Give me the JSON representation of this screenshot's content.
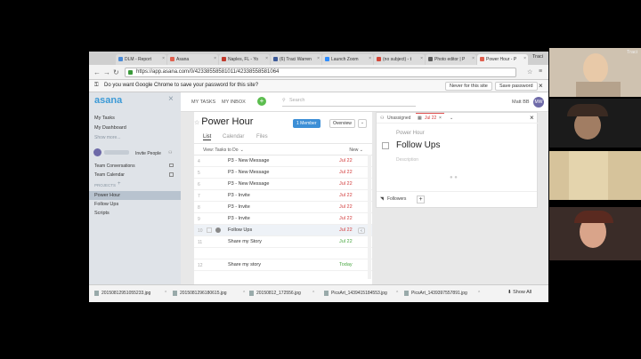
{
  "browser": {
    "tabs": [
      {
        "label": "DLM - Report ",
        "color": "#4a8ad6"
      },
      {
        "label": "Asana",
        "color": "#e0604f"
      },
      {
        "label": "Naples, FL - Yo",
        "color": "#c0392b"
      },
      {
        "label": "(6) Traci Warren",
        "color": "#3b5998"
      },
      {
        "label": "Launch Zoom",
        "color": "#2d8cff"
      },
      {
        "label": "(no subject) - t",
        "color": "#d44638"
      },
      {
        "label": "Photo editor | P",
        "color": "#5a5a5a"
      },
      {
        "label": "Power Hour - P",
        "color": "#e0604f"
      }
    ],
    "user_tab": "Traci",
    "url": "https://app.asana.com/0/42338558581011/42338558581064",
    "password_prompt": "Do you want Google Chrome to save your password for this site?",
    "never_btn": "Never for this site",
    "save_btn": "Save password"
  },
  "sidebar": {
    "logo": "asana",
    "my_tasks": "My Tasks",
    "my_dashboard": "My Dashboard",
    "show_more": "Show more...",
    "invite_people": "Invite People",
    "team_conversations": "Team Conversations",
    "team_calendar": "Team Calendar",
    "projects_label": "PROJECTS",
    "projects": [
      "Power Hour",
      "Follow Ups",
      "Scripts"
    ]
  },
  "topnav": {
    "my_tasks": "MY TASKS",
    "my_inbox": "MY INBOX",
    "search_placeholder": "Search",
    "user_name": "Matt BB",
    "user_initials": "MW"
  },
  "project": {
    "title": "Power Hour",
    "member_btn": "1 Member",
    "overview_btn": "Overview",
    "tabs": [
      "List",
      "Calendar",
      "Files"
    ],
    "view_label": "View: Tasks to Do",
    "new_label": "New",
    "tasks": [
      {
        "num": "4",
        "name": "P3 - New Message",
        "due": "Jul 22",
        "due_color": "red"
      },
      {
        "num": "5",
        "name": "P3 - New Message",
        "due": "Jul 22",
        "due_color": "red"
      },
      {
        "num": "6",
        "name": "P3 - New Message",
        "due": "Jul 22",
        "due_color": "red"
      },
      {
        "num": "7",
        "name": "P3 - Invite",
        "due": "Jul 22",
        "due_color": "red"
      },
      {
        "num": "8",
        "name": "P3 - Invite",
        "due": "Jul 22",
        "due_color": "red"
      },
      {
        "num": "9",
        "name": "P3 - Invite",
        "due": "Jul 22",
        "due_color": "red"
      },
      {
        "num": "10",
        "name": "Follow Ups",
        "due": "Jul 22",
        "due_color": "red"
      },
      {
        "num": "11",
        "name": "Share my Story",
        "due": "Jul 22",
        "due_color": "green"
      },
      {
        "num": "",
        "name": "",
        "due": "",
        "due_color": "red"
      },
      {
        "num": "12",
        "name": "Share my story",
        "due": "Today",
        "due_color": "green"
      }
    ]
  },
  "detail": {
    "assignee": "Unassigned",
    "due": "Jul 22",
    "project": "Power Hour",
    "title": "Follow Ups",
    "description_placeholder": "Description",
    "followers_label": "Followers"
  },
  "downloads": [
    "20150812951055233.jpg",
    "2015081296180615.jpg",
    "20150812_172556.jpg",
    "PicsArt_1439415184553.jpg",
    "PicsArt_1439397557891.jpg"
  ],
  "show_all": "Show All"
}
